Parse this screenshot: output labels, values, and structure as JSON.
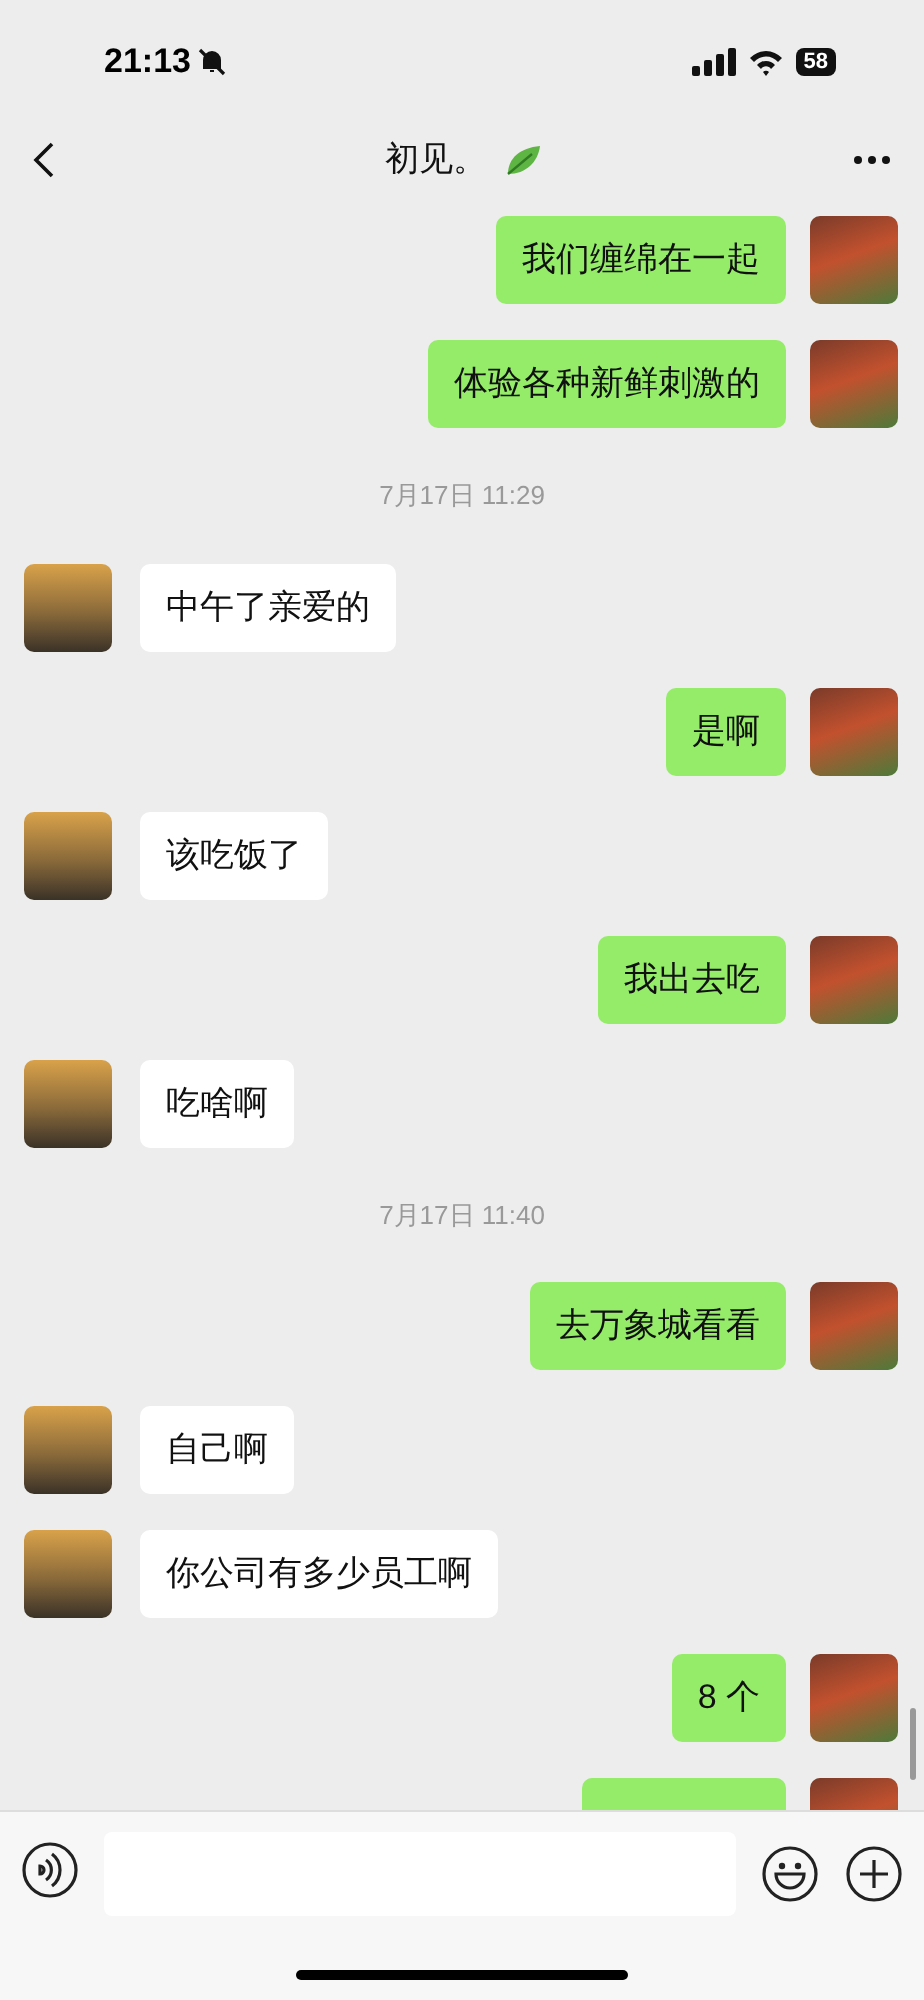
{
  "status_bar": {
    "time": "21:13",
    "battery": "58"
  },
  "header": {
    "title": "初见。"
  },
  "messages": [
    {
      "kind": "message",
      "outgoing": true,
      "text": "我们缠绵在一起"
    },
    {
      "kind": "message",
      "outgoing": true,
      "text": "体验各种新鲜刺激的"
    },
    {
      "kind": "time",
      "text": "7月17日 11:29"
    },
    {
      "kind": "message",
      "outgoing": false,
      "text": "中午了亲爱的"
    },
    {
      "kind": "message",
      "outgoing": true,
      "text": "是啊"
    },
    {
      "kind": "message",
      "outgoing": false,
      "text": "该吃饭了"
    },
    {
      "kind": "message",
      "outgoing": true,
      "text": "我出去吃"
    },
    {
      "kind": "message",
      "outgoing": false,
      "text": "吃啥啊"
    },
    {
      "kind": "time",
      "text": "7月17日 11:40"
    },
    {
      "kind": "message",
      "outgoing": true,
      "text": "去万象城看看"
    },
    {
      "kind": "message",
      "outgoing": false,
      "text": "自己啊"
    },
    {
      "kind": "message",
      "outgoing": false,
      "text": "你公司有多少员工啊"
    },
    {
      "kind": "message",
      "outgoing": true,
      "text": "8 个"
    },
    {
      "kind": "partial",
      "outgoing": true
    }
  ]
}
